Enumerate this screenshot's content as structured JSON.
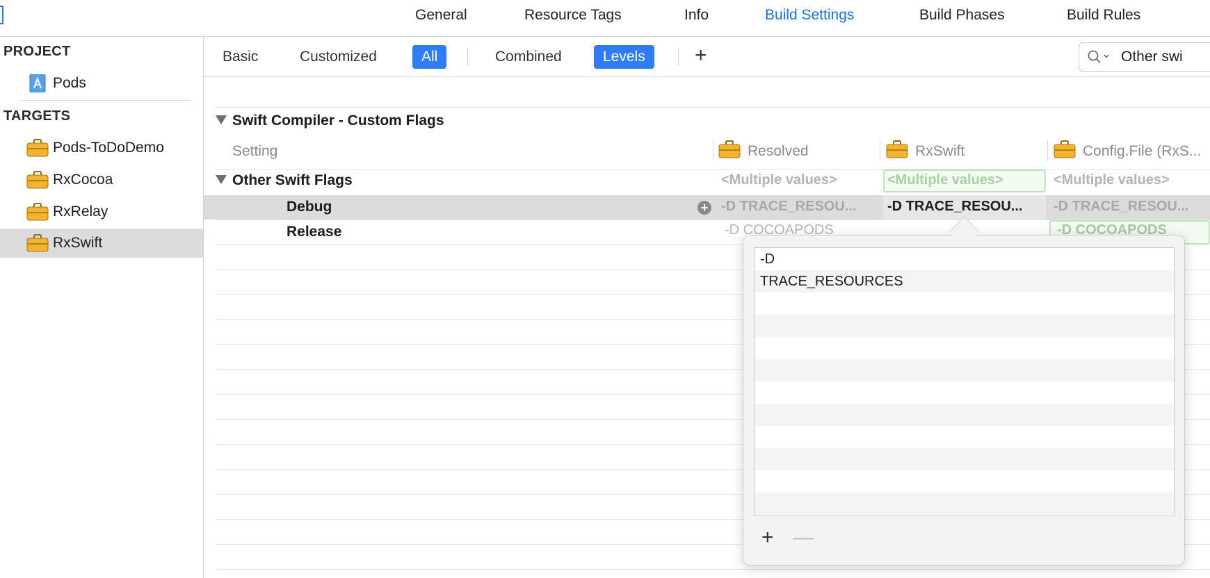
{
  "top_tabs": [
    {
      "label": "General",
      "active": false
    },
    {
      "label": "Resource Tags",
      "active": false
    },
    {
      "label": "Info",
      "active": false
    },
    {
      "label": "Build Settings",
      "active": true
    },
    {
      "label": "Build Phases",
      "active": false
    },
    {
      "label": "Build Rules",
      "active": false
    }
  ],
  "sidebar": {
    "project_header": "PROJECT",
    "project_item": {
      "label": "Pods",
      "icon": "app-project-icon"
    },
    "targets_header": "TARGETS",
    "targets": [
      {
        "label": "Pods-ToDoDemo",
        "icon": "toolbox-icon",
        "selected": false
      },
      {
        "label": "RxCocoa",
        "icon": "toolbox-icon",
        "selected": false
      },
      {
        "label": "RxRelay",
        "icon": "toolbox-icon",
        "selected": false
      },
      {
        "label": "RxSwift",
        "icon": "toolbox-icon",
        "selected": true
      }
    ]
  },
  "filter_bar": {
    "scope_tabs": [
      {
        "label": "Basic",
        "on": false
      },
      {
        "label": "Customized",
        "on": false
      },
      {
        "label": "All",
        "on": true
      }
    ],
    "view_tabs": [
      {
        "label": "Combined",
        "on": false
      },
      {
        "label": "Levels",
        "on": true
      }
    ],
    "add_label": "+",
    "search_value": "Other swi"
  },
  "grid": {
    "section_title": "Swift Compiler - Custom Flags",
    "setting_column": "Setting",
    "columns": [
      "Resolved",
      "RxSwift",
      "Config.File (RxS..."
    ],
    "setting_name": "Other Swift Flags",
    "multiple_values": [
      "<Multiple values>",
      "<Multiple values>",
      "<Multiple values>"
    ],
    "debug": {
      "label": "Debug",
      "resolved": "-D TRACE_RESOU...",
      "rxswift": "-D TRACE_RESOU...",
      "config": "-D TRACE_RESOU..."
    },
    "release": {
      "label": "Release",
      "resolved": "-D COCOAPODS",
      "config": "-D COCOAPODS"
    }
  },
  "popover": {
    "items": [
      "-D",
      "TRACE_RESOURCES"
    ],
    "add_label": "+",
    "remove_label": "—"
  },
  "colors": {
    "accent": "#2f7cf6",
    "active_tab_text": "#1a6fe0",
    "selection_gray": "#dcdcdc",
    "level_highlight_green": "#bfe5bf"
  }
}
